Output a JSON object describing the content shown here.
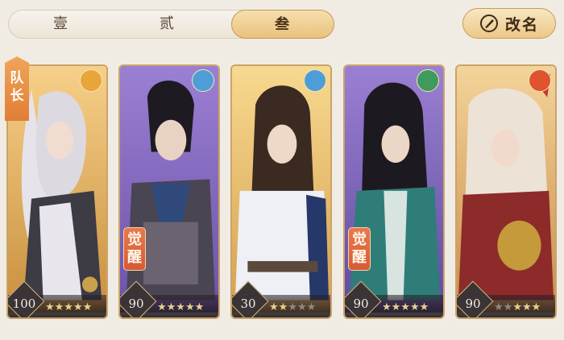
{
  "tabs": [
    {
      "label": "壹",
      "active": false
    },
    {
      "label": "贰",
      "active": false
    },
    {
      "label": "叁",
      "active": true
    }
  ],
  "rename_button": {
    "label": "改名",
    "icon": "brush-circle-icon"
  },
  "leader_tag": "队长",
  "awaken_tag": "觉醒",
  "cards": [
    {
      "level": "100",
      "element": "moon",
      "element_color": "#e8a53a",
      "bg": "warm",
      "stars_lit": 5,
      "awakened": false,
      "leader": true
    },
    {
      "level": "90",
      "element": "water",
      "element_color": "#4d9ed6",
      "bg": "purple",
      "stars_lit": 5,
      "awakened": true,
      "leader": false
    },
    {
      "level": "30",
      "element": "water",
      "element_color": "#4d9ed6",
      "bg": "warm",
      "stars_lit": 2,
      "awakened": false,
      "leader": false
    },
    {
      "level": "90",
      "element": "wind",
      "element_color": "#3f9a5d",
      "bg": "purple",
      "stars_lit": 5,
      "awakened": true,
      "leader": false
    },
    {
      "level": "90",
      "element": "fire",
      "element_color": "#e0532f",
      "bg": "warm",
      "stars_lit": 3,
      "awakened": false,
      "leader": false
    }
  ]
}
